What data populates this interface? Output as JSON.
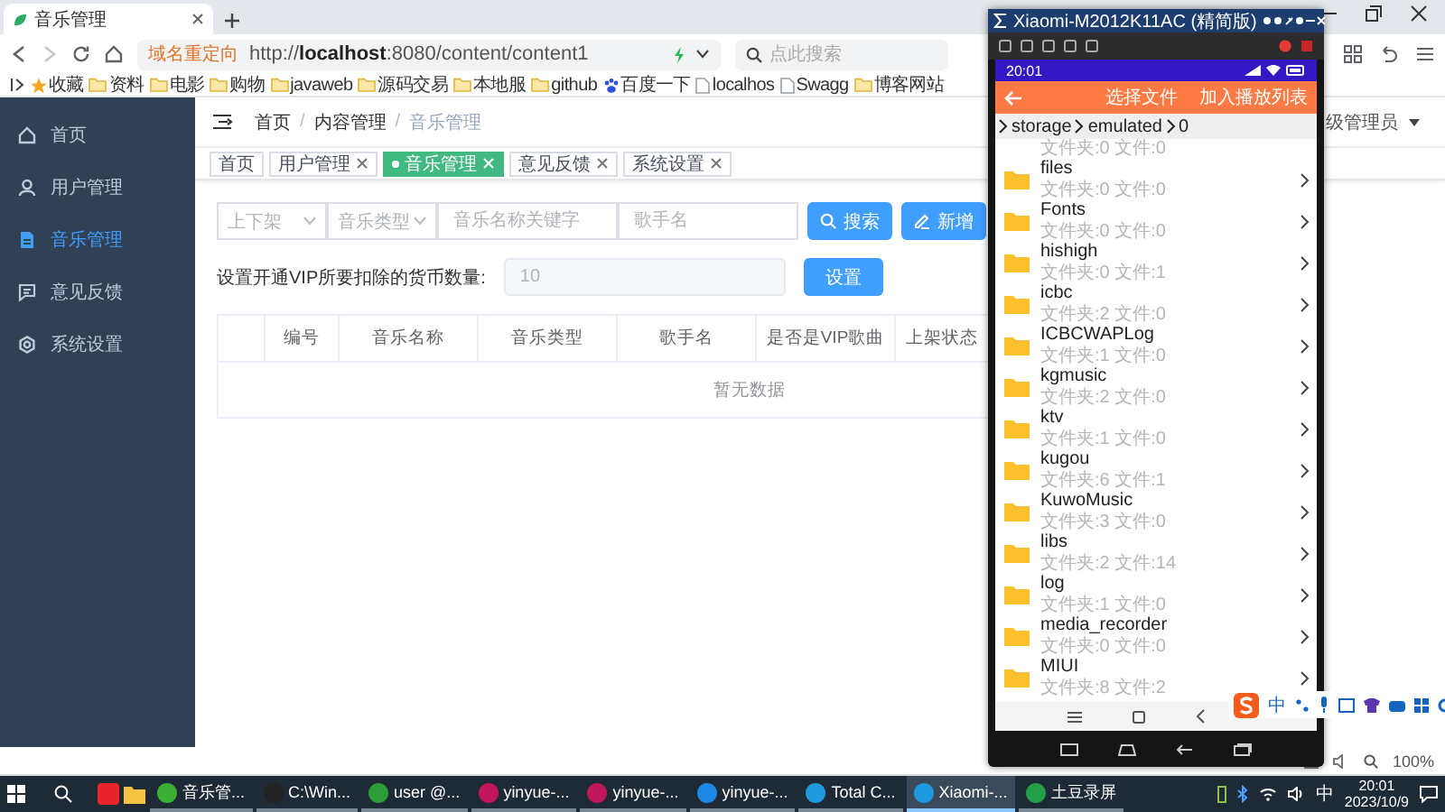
{
  "browser": {
    "tab": {
      "title": "音乐管理"
    },
    "address": {
      "badge": "域名重定向",
      "url": "http://**localhost**:8080/content/content1"
    },
    "search": {
      "placeholder": "点此搜索"
    },
    "bookmarks": [
      {
        "label": "收藏",
        "kind": "star"
      },
      {
        "label": "资料",
        "kind": "folder"
      },
      {
        "label": "电影",
        "kind": "folder"
      },
      {
        "label": "购物",
        "kind": "folder"
      },
      {
        "label": "javaweb",
        "kind": "folder"
      },
      {
        "label": "源码交易",
        "kind": "folder"
      },
      {
        "label": "本地服",
        "kind": "folder"
      },
      {
        "label": "github",
        "kind": "folder"
      },
      {
        "label": "百度一下",
        "kind": "paw"
      },
      {
        "label": "localhos",
        "kind": "page"
      },
      {
        "label": "Swagg",
        "kind": "page"
      },
      {
        "label": "博客网站",
        "kind": "folder"
      }
    ],
    "zoom": "100%"
  },
  "app": {
    "sidebar": {
      "items": [
        {
          "label": "首页",
          "selected": false
        },
        {
          "label": "用户管理",
          "selected": false
        },
        {
          "label": "音乐管理",
          "selected": true
        },
        {
          "label": "意见反馈",
          "selected": false
        },
        {
          "label": "系统设置",
          "selected": false
        }
      ]
    },
    "breadcrumb": [
      "首页",
      "内容管理",
      "音乐管理"
    ],
    "breadcrumb_separator": "/",
    "user": "级管理员",
    "tags": [
      {
        "label": "首页",
        "closable": false,
        "selected": false
      },
      {
        "label": "用户管理",
        "closable": true,
        "selected": false
      },
      {
        "label": "音乐管理",
        "closable": true,
        "selected": true
      },
      {
        "label": "意见反馈",
        "closable": true,
        "selected": false
      },
      {
        "label": "系统设置",
        "closable": true,
        "selected": false
      }
    ],
    "filters": [
      {
        "kind": "select",
        "placeholder": "上下架"
      },
      {
        "kind": "select",
        "placeholder": "音乐类型"
      },
      {
        "kind": "input",
        "placeholder": "音乐名称关键字"
      },
      {
        "kind": "input",
        "placeholder": "歌手名"
      }
    ],
    "buttons": [
      "搜索",
      "新增"
    ],
    "vip": {
      "label": "设置开通VIP所要扣除的货币数量:",
      "value": "10",
      "button": "设置"
    },
    "table": {
      "columns": [
        "编号",
        "音乐名称",
        "音乐类型",
        "歌手名",
        "是否是VIP歌曲",
        "上架状态"
      ],
      "empty": "暂无数据"
    }
  },
  "phone": {
    "window_title": "Xiaomi-M2012K11AC (精简版)",
    "time": "20:01",
    "actions": [
      "选择文件",
      "加入播放列表"
    ],
    "path": [
      "storage",
      "emulated",
      "0"
    ],
    "partial_row_meta": "文件夹:0 文件:0",
    "files": [
      {
        "name": "files",
        "meta": "文件夹:0 文件:0"
      },
      {
        "name": "Fonts",
        "meta": "文件夹:0 文件:0"
      },
      {
        "name": "hishigh",
        "meta": "文件夹:0 文件:1"
      },
      {
        "name": "icbc",
        "meta": "文件夹:2 文件:0"
      },
      {
        "name": "ICBCWAPLog",
        "meta": "文件夹:1 文件:0"
      },
      {
        "name": "kgmusic",
        "meta": "文件夹:2 文件:0"
      },
      {
        "name": "ktv",
        "meta": "文件夹:1 文件:0"
      },
      {
        "name": "kugou",
        "meta": "文件夹:6 文件:1"
      },
      {
        "name": "KuwoMusic",
        "meta": "文件夹:3 文件:0"
      },
      {
        "name": "libs",
        "meta": "文件夹:2 文件:14"
      },
      {
        "name": "log",
        "meta": "文件夹:1 文件:0"
      },
      {
        "name": "media_recorder",
        "meta": "文件夹:0 文件:0"
      },
      {
        "name": "MIUI",
        "meta": "文件夹:8 文件:2"
      }
    ]
  },
  "ime": {
    "mode": "中"
  },
  "taskbar": {
    "items": [
      {
        "color": "#e8232a"
      }
    ],
    "apps": [
      {
        "label": "音乐管...",
        "color": "#3cb034",
        "selected": false
      },
      {
        "label": "C:\\Win...",
        "color": "#222222",
        "selected": false
      },
      {
        "label": "user @...",
        "color": "#2e9e3a",
        "selected": false
      },
      {
        "label": "yinyue-...",
        "color": "#c2185b",
        "selected": false
      },
      {
        "label": "yinyue-...",
        "color": "#c2185b",
        "selected": false
      },
      {
        "label": "yinyue-...",
        "color": "#1e88e5",
        "selected": false
      },
      {
        "label": "Total C...",
        "color": "#1e9be0",
        "selected": false
      },
      {
        "label": "Xiaomi-...",
        "color": "#1e9be0",
        "selected": true
      },
      {
        "label": "土豆录屏",
        "color": "#24a148",
        "selected": false
      }
    ],
    "ime": "中",
    "time": "20:01",
    "date": "2023/10/9"
  }
}
